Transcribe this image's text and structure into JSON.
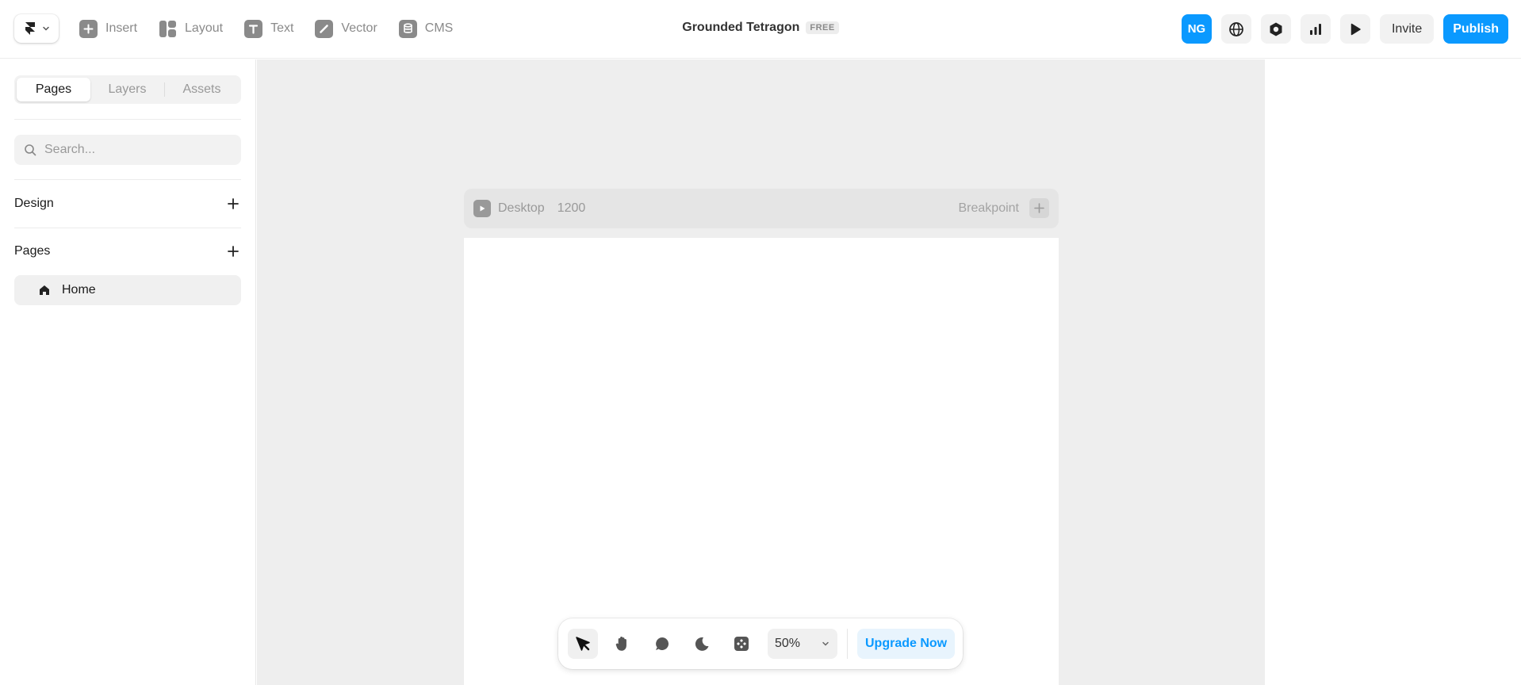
{
  "toolbar": {
    "items": [
      {
        "label": "Insert",
        "icon": "plus-square-icon"
      },
      {
        "label": "Layout",
        "icon": "layout-icon"
      },
      {
        "label": "Text",
        "icon": "text-icon"
      },
      {
        "label": "Vector",
        "icon": "pen-icon"
      },
      {
        "label": "CMS",
        "icon": "database-icon"
      }
    ]
  },
  "project": {
    "name": "Grounded Tetragon",
    "plan_badge": "FREE"
  },
  "header_right": {
    "avatar_initials": "NG",
    "invite_label": "Invite",
    "publish_label": "Publish",
    "icons": [
      "globe-icon",
      "settings-hexagon-icon",
      "analytics-icon",
      "play-icon"
    ]
  },
  "sidebar": {
    "tabs": [
      "Pages",
      "Layers",
      "Assets"
    ],
    "active_tab": "Pages",
    "search_placeholder": "Search...",
    "sections": [
      {
        "title": "Design"
      },
      {
        "title": "Pages"
      }
    ],
    "pages": [
      {
        "label": "Home",
        "icon": "home-icon"
      }
    ]
  },
  "canvas": {
    "breakpoint_name": "Desktop",
    "breakpoint_width": "1200",
    "breakpoint_label": "Breakpoint"
  },
  "bottom_toolbar": {
    "tools": [
      "cursor-icon",
      "hand-icon",
      "comment-icon",
      "moon-icon",
      "components-icon"
    ],
    "active_tool": "cursor-icon",
    "zoom": "50%",
    "upgrade_label": "Upgrade Now"
  },
  "colors": {
    "accent": "#0a99ff",
    "canvas_bg": "#eeeeee",
    "muted_text": "#8a8a8a"
  }
}
